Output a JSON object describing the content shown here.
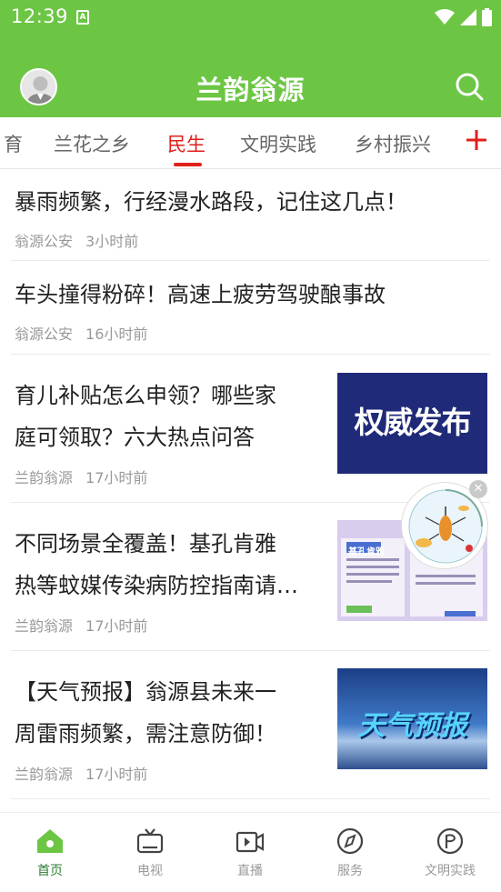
{
  "status": {
    "time": "12:39",
    "notif_letter": "A"
  },
  "header": {
    "title": "兰韵翁源"
  },
  "tabs": [
    {
      "label": "育"
    },
    {
      "label": "兰花之乡"
    },
    {
      "label": "民生",
      "active": true
    },
    {
      "label": "文明实践"
    },
    {
      "label": "乡村振兴"
    }
  ],
  "news": [
    {
      "title": "暴雨频繁，行经漫水路段，记住这几点！",
      "source": "翁源公安",
      "time": "3小时前"
    },
    {
      "title": "车头撞得粉碎！高速上疲劳驾驶酿事故",
      "source": "翁源公安",
      "time": "16小时前"
    },
    {
      "title_line1": "育儿补贴怎么申领？哪些家",
      "title_line2": "庭可领取？六大热点问答",
      "source": "兰韵翁源",
      "time": "17小时前",
      "thumb_text": "权威发布"
    },
    {
      "title_line1": "不同场景全覆盖！基孔肯雅",
      "title_line2": "热等蚊媒传染病防控指南请…",
      "source": "兰韵翁源",
      "time": "17小时前",
      "thumb_text": "基孔肯雅"
    },
    {
      "title_line1": "【天气预报】翁源县未来一",
      "title_line2": "周雷雨频繁，需注意防御！",
      "source": "兰韵翁源",
      "time": "17小时前",
      "thumb_text": "天气预报"
    }
  ],
  "float_close": "✕",
  "bottom_nav": [
    {
      "label": "首页",
      "icon": "home-icon",
      "active": true
    },
    {
      "label": "电视",
      "icon": "tv-icon"
    },
    {
      "label": "直播",
      "icon": "live-video-icon"
    },
    {
      "label": "服务",
      "icon": "compass-icon"
    },
    {
      "label": "文明实践",
      "icon": "flag-icon"
    }
  ],
  "colors": {
    "brand_green": "#6cc644",
    "active_red": "#e0201c",
    "nav_active": "#2e7d32"
  }
}
